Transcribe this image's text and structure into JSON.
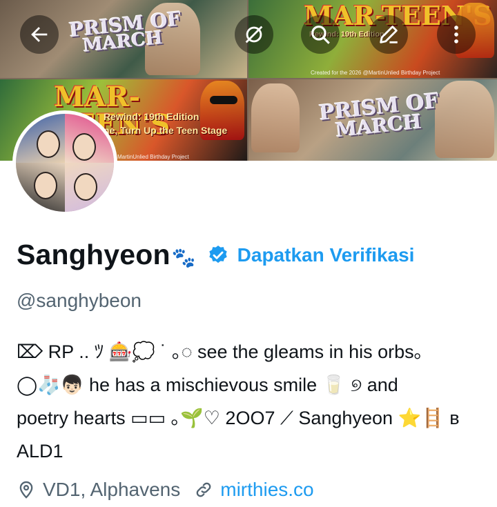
{
  "banner": {
    "title_prism": "PRISM OF",
    "title_march": "MARCH",
    "title_marteen": "MAR-TEEN'S",
    "subtitle_rewind": "Rewind: 19th Edition",
    "subtitle_tape": "ne, Turn Up the Teen Stage",
    "credit": "MartinUnlied Birthday Project",
    "credit_created": "Created for the 2026 @MartinUnlied Birthday Project"
  },
  "header": {
    "back_icon": "arrow-left-icon",
    "hide_icon": "eye-slash-icon",
    "search_icon": "search-icon",
    "edit_icon": "pencil-icon",
    "more_icon": "more-vertical-icon"
  },
  "profile": {
    "name": "Sanghyeon",
    "name_emoji": "🐾",
    "verify_link": "Dapatkan Verifikasi",
    "handle": "@sanghybeon",
    "bio_lines": [
      "⌦ RP .. ﾂ 🎰💭 ˙ ｡◌ see the gleams in his orbs｡",
      "◯🧦👦🏻 he has a mischievous smile 🥛 ୭ and",
      "poetry hearts ▭▭ ｡🌱♡ 2OO7 ⟋ Sanghyeon ⭐🪜 ʙ",
      "ALD1"
    ],
    "location": "VD1, Alphavens",
    "website": "mirthies.co"
  },
  "colors": {
    "accent": "#1d9bf0",
    "secondary_text": "#536471",
    "primary_text": "#0f1419"
  }
}
